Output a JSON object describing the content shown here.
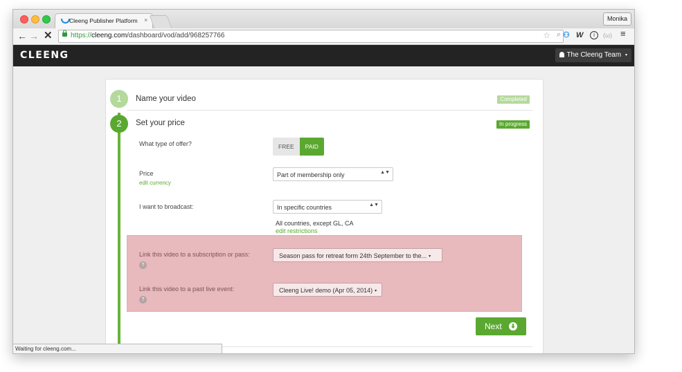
{
  "browser": {
    "tab_title": "Cleeng Publisher Platform",
    "tab_close": "×",
    "profile": "Monika",
    "url_scheme": "https://",
    "url_host": "cleeng.com",
    "url_path": "/dashboard/vod/add/968257766",
    "back": "←",
    "forward": "→",
    "stop": "✕",
    "ext_w": "W",
    "ext_info": "i",
    "ext_misc": "(ω)",
    "menu": "≡",
    "star": "☆",
    "zoom": "⌕",
    "ext_person": "⚇",
    "status": "Waiting for cleeng.com..."
  },
  "app": {
    "logo": "CLEENG",
    "user_menu": "The Cleeng Team",
    "user_caret": "▾"
  },
  "steps": [
    {
      "number": "1",
      "title": "Name your video",
      "status": "Completed"
    },
    {
      "number": "2",
      "title": "Set your price",
      "status": "In progress"
    }
  ],
  "form": {
    "offer_type_label": "What type of offer?",
    "offer_free": "FREE",
    "offer_paid": "PAID",
    "offer_selected": "PAID",
    "price_label": "Price",
    "edit_currency": "edit currency",
    "price_value": "Part of membership only",
    "broadcast_label": "I want to broadcast:",
    "broadcast_value": "In specific countries",
    "countries_text": "All countries, except GL, CA",
    "edit_restrictions": "edit restrictions",
    "subscription_label": "Link this video to a subscription or pass:",
    "subscription_value": "Season pass for retreat form 24th September to the...",
    "live_event_label": "Link this video to a past live event:",
    "live_event_value": "Cleeng Live! demo (Apr 05, 2014)",
    "help": "?",
    "select_arrows": "▲▼",
    "caret": "▾",
    "next": "Next"
  },
  "colors": {
    "accent_green": "#5aa830",
    "light_green": "#b5d99c",
    "highlight_pink": "#e8b9bd",
    "appbar": "#232323"
  }
}
